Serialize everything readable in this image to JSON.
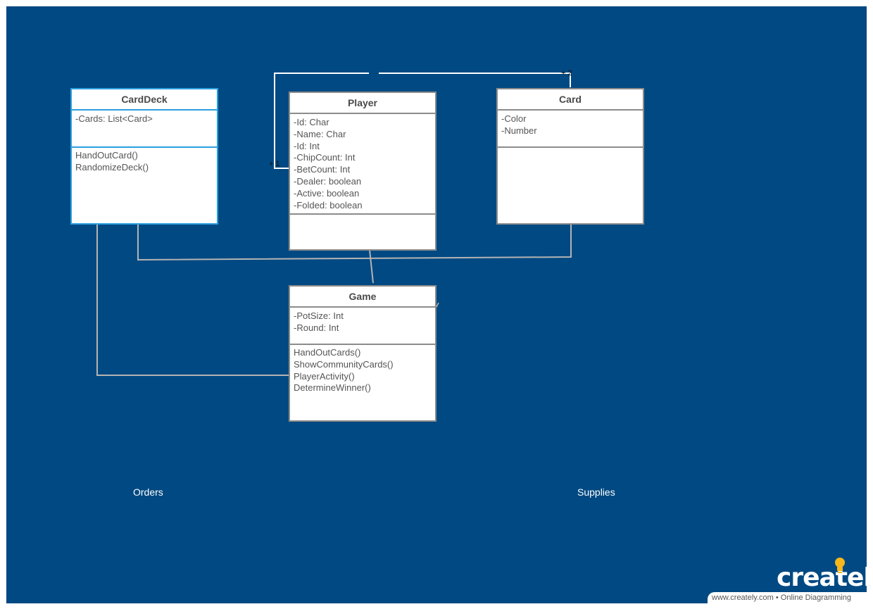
{
  "classes": {
    "carddeck": {
      "name": "CardDeck",
      "attributes": [
        "-Cards: List<Card>"
      ],
      "operations": [
        "HandOutCard()",
        "RandomizeDeck()"
      ]
    },
    "player": {
      "name": "Player",
      "attributes": [
        "-Id: Char",
        "-Name: Char",
        "-Id: Int",
        "-ChipCount: Int",
        "-BetCount: Int",
        "-Dealer: boolean",
        "-Active: boolean",
        "-Folded: boolean"
      ],
      "operations": []
    },
    "card": {
      "name": "Card",
      "attributes": [
        "-Color",
        "-Number"
      ],
      "operations": []
    },
    "game": {
      "name": "Game",
      "attributes": [
        "-PotSize: Int",
        "-Round: Int"
      ],
      "operations": [
        "HandOutCards()",
        "ShowCommunityCards()",
        "PlayerActivity()",
        "DetermineWinner()"
      ]
    }
  },
  "multiplicities": {
    "player_end": "+ 1",
    "card_end": "+ 2"
  },
  "captions": {
    "left": "Orders",
    "right": "Supplies"
  },
  "branding": {
    "logo": "creately",
    "footer": "www.creately.com • Online Diagramming"
  },
  "colors": {
    "background": "#014982",
    "box_border": "#8c8c8c",
    "selected_border": "#2b9fdf",
    "connector": "#b4b4b4",
    "logo_accent": "#f5b81c"
  }
}
